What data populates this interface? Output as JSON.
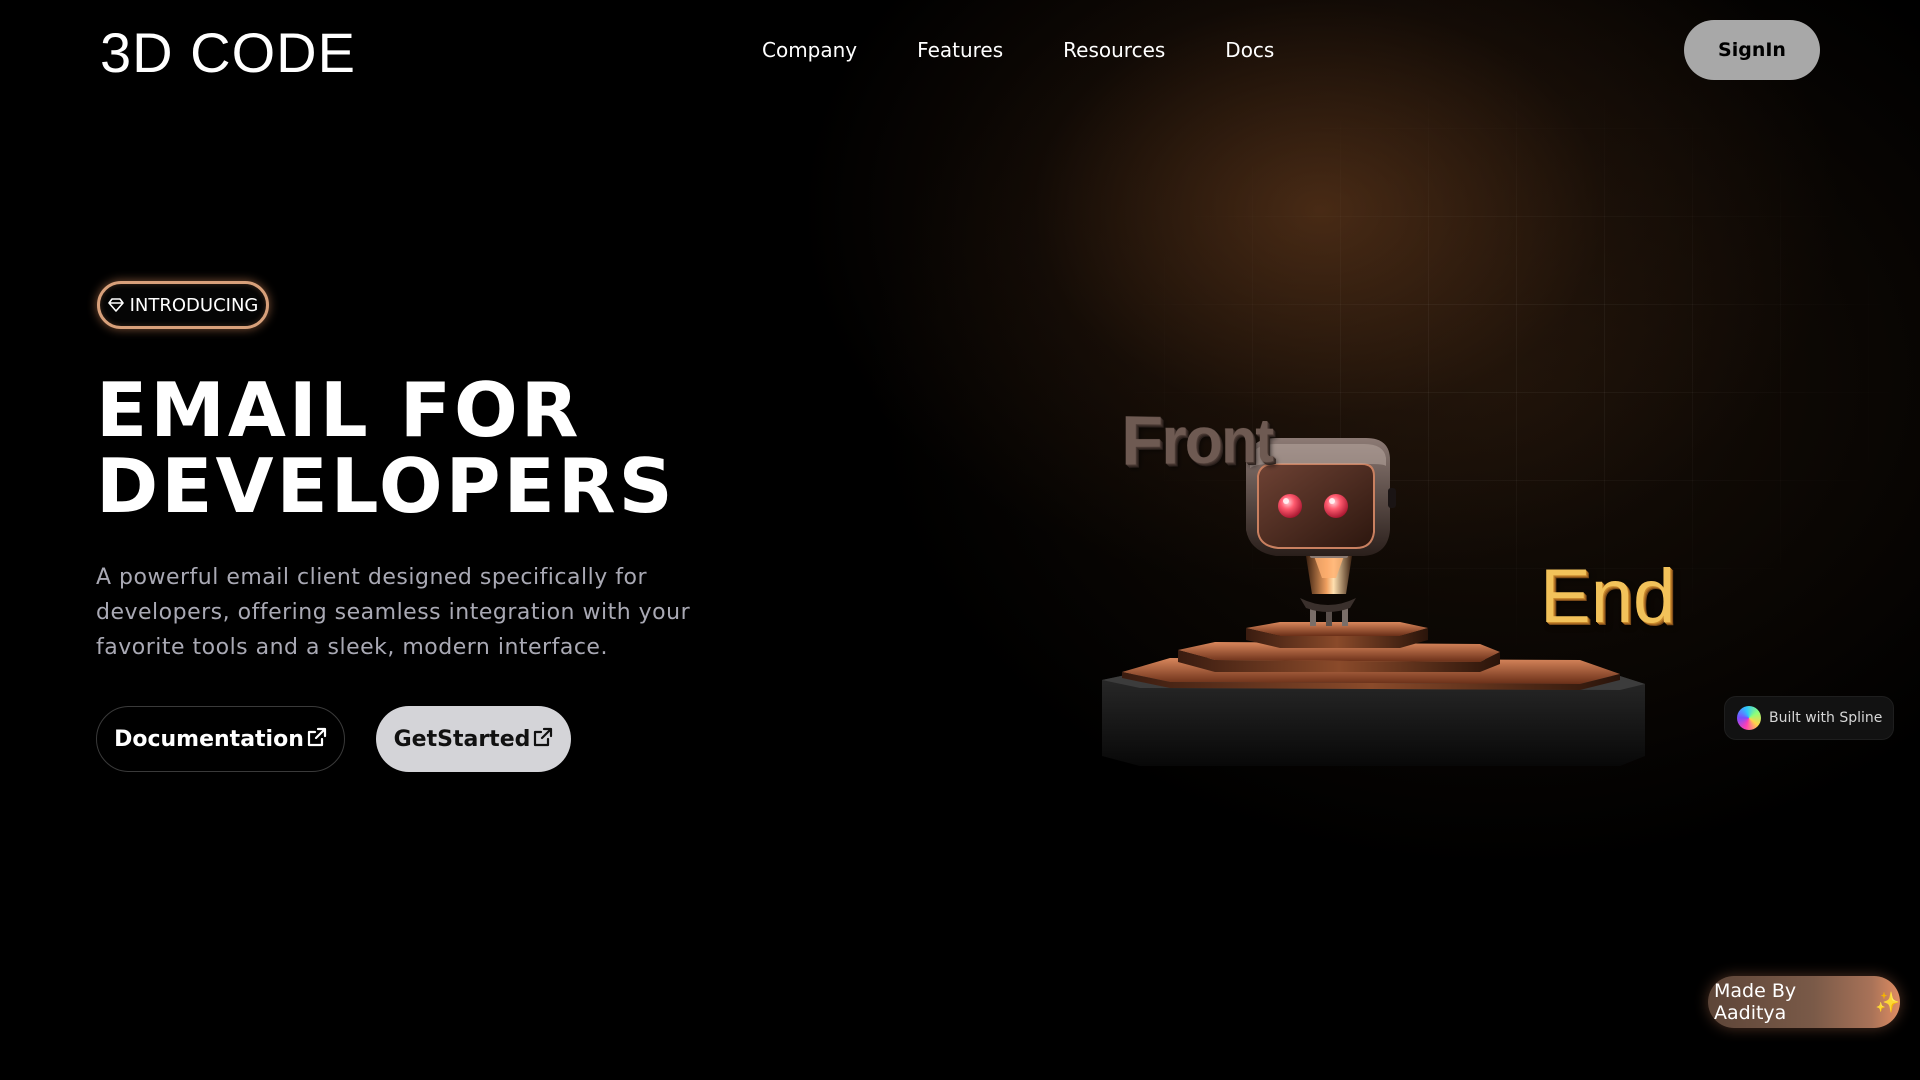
{
  "header": {
    "logo": "3D CODE",
    "nav": [
      "Company",
      "Features",
      "Resources",
      "Docs"
    ],
    "signin_label": "SignIn"
  },
  "hero": {
    "badge_label": "INTRODUCING",
    "title_line1": "EMAIL FOR",
    "title_line2": "DEVELOPERS",
    "description": "A powerful email client designed specifically for developers, offering seamless integration with your favorite tools and a sleek, modern interface.",
    "btn_documentation": "Documentation",
    "btn_get_started": "GetStarted"
  },
  "scene": {
    "word_front": "Front",
    "word_end": "End"
  },
  "spline_badge": "Built with Spline",
  "made_by": "Made By Aaditya",
  "icons": [
    "gem-icon",
    "external-link-icon",
    "spline-logo-icon",
    "sparkle-icon",
    "robot-illustration"
  ],
  "colors": {
    "accent_border": "#d8a07a",
    "signin_bg": "#a8a8a8",
    "get_started_bg": "#d4d4d8",
    "end_text": "#f2c25a"
  }
}
